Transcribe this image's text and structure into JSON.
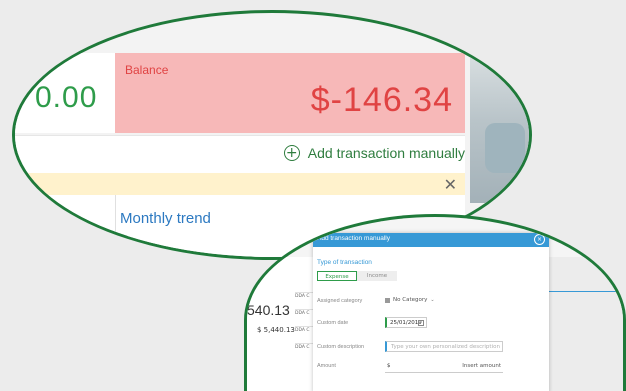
{
  "top_panel": {
    "amount_fragment": "0.00",
    "balance_label": "Balance",
    "balance_value": "$-146.34",
    "add_transaction_label": "Add transaction manually",
    "monthly_trend_label": "Monthly trend"
  },
  "background": {
    "amount_fragment": "540.13",
    "amount_small": "$ 5,440.13",
    "rows": [
      "DDA C",
      "DDA C",
      "DDA C",
      "DDA C"
    ]
  },
  "modal": {
    "title": "Add transaction manually",
    "type_label": "Type of transaction",
    "types": [
      "Expense",
      "Income"
    ],
    "assigned_category_label": "Assigned category",
    "category_value": "No Category",
    "custom_date_label": "Custom date",
    "custom_date_value": "25/01/2019",
    "custom_description_label": "Custom description",
    "custom_description_placeholder": "Type your own personalized description",
    "amount_label": "Amount",
    "amount_currency": "$",
    "amount_placeholder": "Insert amount"
  },
  "colors": {
    "accent_green": "#2e9c4a",
    "balance_red": "#e04343",
    "balance_bg": "#f7b8b8",
    "modal_blue": "#3799d6",
    "notice_yellow": "#fff2cc"
  }
}
